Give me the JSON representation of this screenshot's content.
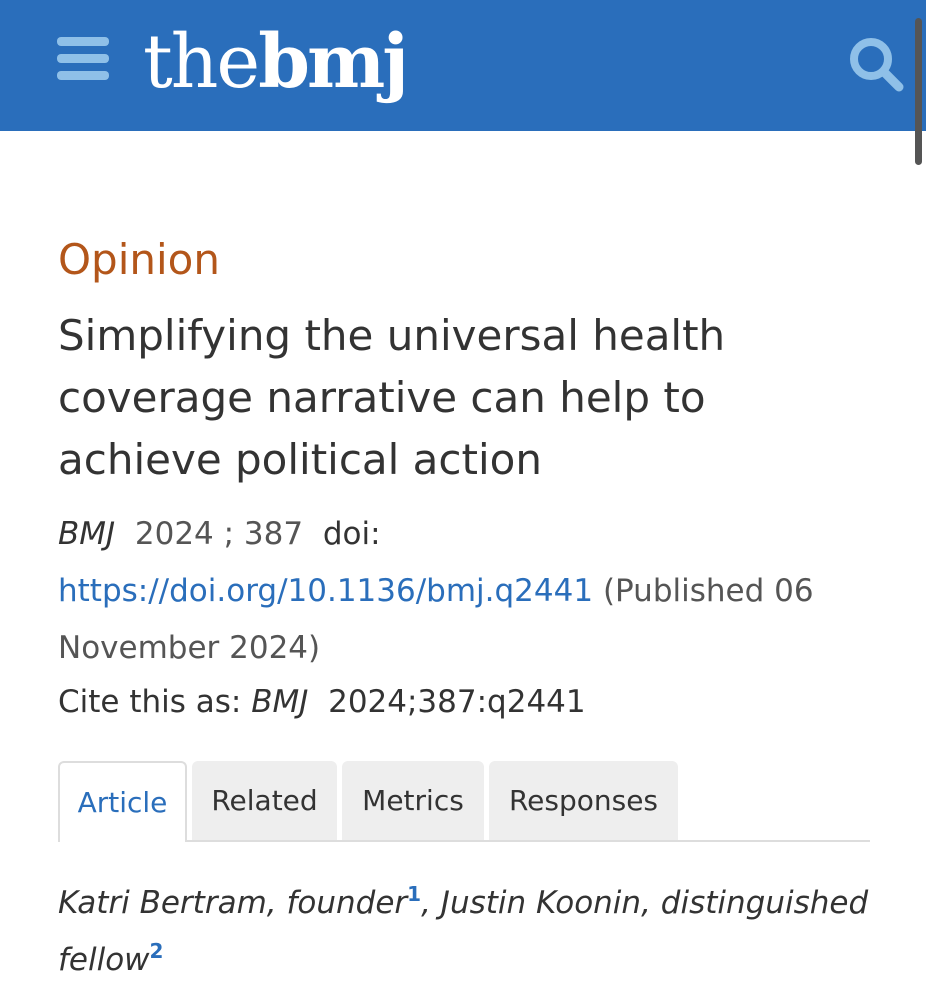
{
  "header": {
    "logo_the": "the",
    "logo_bmj": "bmj",
    "menu_icon": "hamburger-menu-icon",
    "search_icon": "search-icon",
    "background_color": "#2a6ebb"
  },
  "article": {
    "type": "Opinion",
    "title": "Simplifying the universal health coverage narrative can help to achieve political action",
    "citation": {
      "journal": "BMJ",
      "year_volume": "2024 ; 387",
      "doi_label": "doi:",
      "doi_url": "https://doi.org/10.1136/bmj.q2441",
      "published": "(Published 06 November 2024)"
    },
    "cite_as": {
      "label": "Cite this as:",
      "journal": "BMJ",
      "ref": "2024;387:q2441"
    },
    "tabs": [
      {
        "label": "Article",
        "active": true
      },
      {
        "label": "Related",
        "active": false
      },
      {
        "label": "Metrics",
        "active": false
      },
      {
        "label": "Responses",
        "active": false
      }
    ],
    "authors": [
      {
        "name": "Katri Bertram, founder",
        "affiliation": "1"
      },
      {
        "name": "Justin Koonin, distinguished fellow",
        "affiliation": "2"
      }
    ]
  },
  "colors": {
    "accent": "#2a6ebb",
    "article_type": "#b3561a"
  }
}
